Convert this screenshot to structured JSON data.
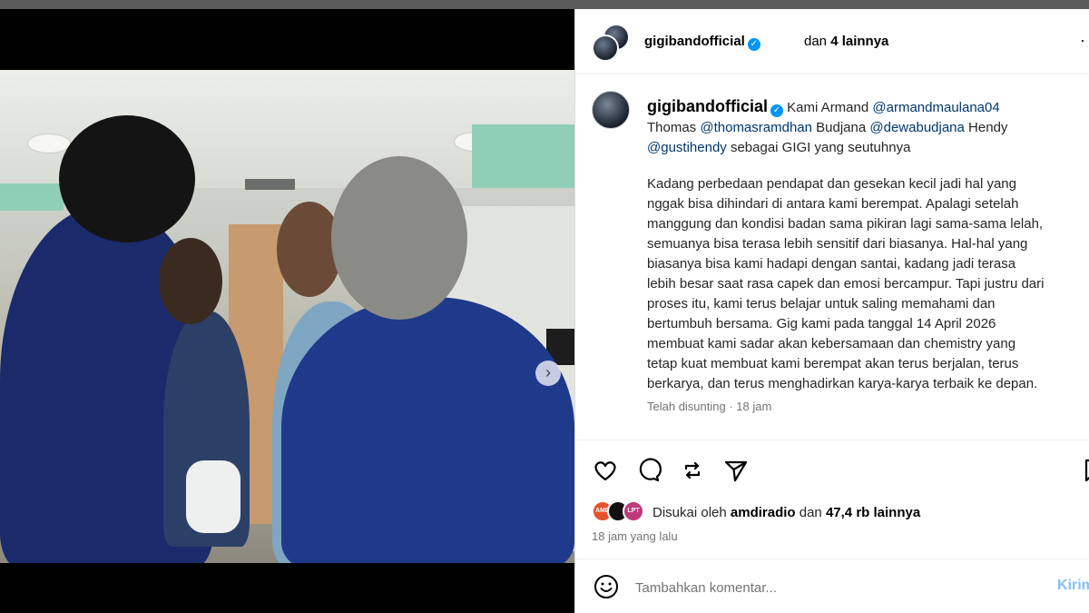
{
  "post": {
    "header": {
      "username": "gigibandofficial",
      "verified_icon": "verified-badge-icon",
      "others_prefix": "dan",
      "others_count": "4 lainnya"
    },
    "caption": {
      "username": "gigibandofficial",
      "intro": "Kami Armand",
      "mention_armand": "@armandmaulana04",
      "name_thomas": "Thomas",
      "mention_thomas": "@thomasramdhan",
      "name_budjana": "Budjana",
      "mention_budjana": "@dewabudjana",
      "name_hendy": "Hendy",
      "mention_hendy": "@gustihendy",
      "intro_end": "sebagai GIGI yang seutuhnya",
      "body_lines": [
        "Kadang perbedaan pendapat dan gesekan kecil jadi hal yang",
        "nggak bisa dihindari di antara kami berempat. Apalagi setelah",
        "manggung dan kondisi badan sama pikiran lagi sama-sama lelah,",
        "semuanya bisa terasa lebih sensitif dari biasanya. Hal-hal yang",
        "biasanya bisa kami hadapi dengan santai, kadang jadi terasa",
        "lebih besar saat rasa capek dan emosi bercampur. Tapi justru dari",
        "proses itu, kami terus belajar untuk saling memahami dan",
        "bertumbuh bersama. Gig kami pada tanggal 14 April 2026",
        "membuat kami sadar akan kebersamaan dan chemistry yang",
        "tetap kuat membuat kami berempat akan terus berjalan, terus",
        "berkarya, dan terus menghadirkan karya-karya terbaik ke depan."
      ],
      "edited_label": "Telah disunting",
      "edited_time": "18 jam"
    },
    "likes": {
      "prefix": "Disukai oleh",
      "liker": "amdiradio",
      "suffix_dan": "dan",
      "count": "47,4 rb lainnya",
      "avatar_labels": [
        "AMD",
        "",
        "LPT"
      ]
    },
    "time_ago": "18 jam yang lalu",
    "comment": {
      "placeholder": "Tambahkan komentar...",
      "send_label": "Kirim"
    },
    "colors": {
      "accent": "#0095f6",
      "mention": "#00376b",
      "send_disabled": "#85c0f9",
      "active_dot": "#3897f0"
    }
  }
}
